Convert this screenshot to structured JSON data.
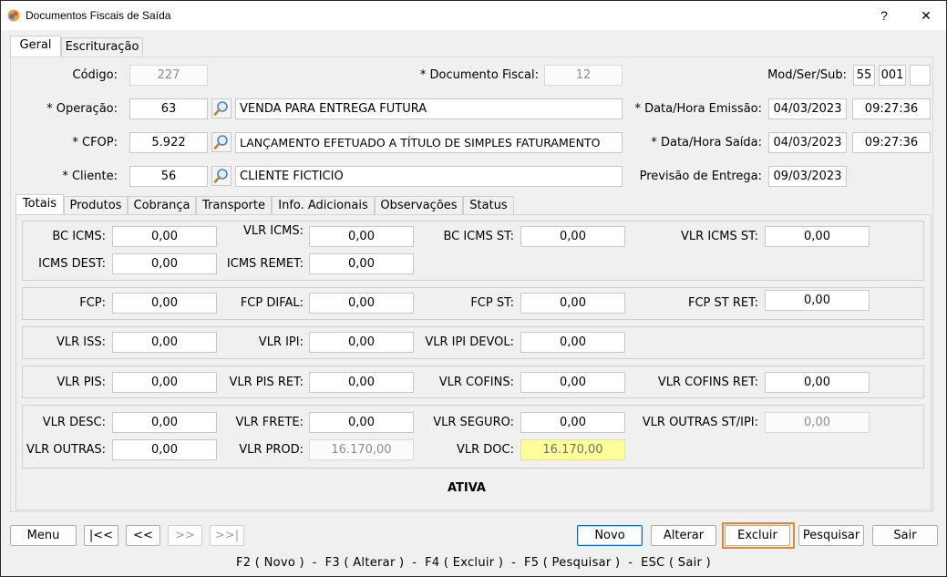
{
  "window": {
    "title": "Documentos Fiscais de Saída",
    "help_label": "?",
    "close_label": "✕"
  },
  "main_tabs": [
    {
      "label": "Geral",
      "active": true
    },
    {
      "label": "Escrituração",
      "active": false
    }
  ],
  "header": {
    "codigo_label": "Código:",
    "codigo_value": "227",
    "documento_fiscal_label": "* Documento Fiscal:",
    "documento_fiscal_value": "12",
    "mod_ser_sub_label": "Mod/Ser/Sub:",
    "mod_value": "55",
    "ser_value": "001",
    "sub_value": "",
    "operacao_label": "* Operação:",
    "operacao_code": "63",
    "operacao_desc": "VENDA PARA ENTREGA FUTURA",
    "data_hora_emissao_label": "* Data/Hora Emissão:",
    "data_emissao": "04/03/2023",
    "hora_emissao": "09:27:36",
    "cfop_label": "* CFOP:",
    "cfop_code": "5.922",
    "cfop_desc": "LANÇAMENTO EFETUADO A TÍTULO DE SIMPLES FATURAMENTO",
    "data_hora_saida_label": "* Data/Hora Saída:",
    "data_saida": "04/03/2023",
    "hora_saida": "09:27:36",
    "cliente_label": "* Cliente:",
    "cliente_code": "56",
    "cliente_desc": "CLIENTE FICTICIO",
    "previsao_entrega_label": "Previsão de Entrega:",
    "previsao_entrega_value": "09/03/2023"
  },
  "sub_tabs": [
    {
      "label": "Totais",
      "active": true
    },
    {
      "label": "Produtos",
      "active": false
    },
    {
      "label": "Cobrança",
      "active": false
    },
    {
      "label": "Transporte",
      "active": false
    },
    {
      "label": "Info. Adicionais",
      "active": false
    },
    {
      "label": "Observações",
      "active": false
    },
    {
      "label": "Status",
      "active": false
    }
  ],
  "totais": {
    "bc_icms_label": "BC ICMS:",
    "bc_icms": "0,00",
    "vlr_icms_label": "VLR ICMS:",
    "vlr_icms": "0,00",
    "bc_icms_st_label": "BC ICMS ST:",
    "bc_icms_st": "0,00",
    "vlr_icms_st_label": "VLR ICMS ST:",
    "vlr_icms_st": "0,00",
    "icms_dest_label": "ICMS DEST:",
    "icms_dest": "0,00",
    "icms_remet_label": "ICMS REMET:",
    "icms_remet": "0,00",
    "fcp_label": "FCP:",
    "fcp": "0,00",
    "fcp_difal_label": "FCP DIFAL:",
    "fcp_difal": "0,00",
    "fcp_st_label": "FCP ST:",
    "fcp_st": "0,00",
    "fcp_st_ret_label": "FCP ST RET:",
    "fcp_st_ret": "0,00",
    "vlr_iss_label": "VLR ISS:",
    "vlr_iss": "0,00",
    "vlr_ipi_label": "VLR IPI:",
    "vlr_ipi": "0,00",
    "vlr_ipi_devol_label": "VLR IPI DEVOL:",
    "vlr_ipi_devol": "0,00",
    "vlr_pis_label": "VLR PIS:",
    "vlr_pis": "0,00",
    "vlr_pis_ret_label": "VLR PIS RET:",
    "vlr_pis_ret": "0,00",
    "vlr_cofins_label": "VLR COFINS:",
    "vlr_cofins": "0,00",
    "vlr_cofins_ret_label": "VLR COFINS RET:",
    "vlr_cofins_ret": "0,00",
    "vlr_desc_label": "VLR DESC:",
    "vlr_desc": "0,00",
    "vlr_frete_label": "VLR FRETE:",
    "vlr_frete": "0,00",
    "vlr_seguro_label": "VLR SEGURO:",
    "vlr_seguro": "0,00",
    "vlr_outras_st_ipi_label": "VLR OUTRAS ST/IPI:",
    "vlr_outras_st_ipi": "0,00",
    "vlr_outras_label": "VLR OUTRAS:",
    "vlr_outras": "0,00",
    "vlr_prod_label": "VLR PROD:",
    "vlr_prod": "16.170,00",
    "vlr_doc_label": "VLR DOC:",
    "vlr_doc": "16.170,00"
  },
  "status_text": "ATIVA",
  "buttons": {
    "menu": "Menu",
    "first": "|<<",
    "prev": "<<",
    "next": ">>",
    "last": ">>|",
    "novo": "Novo",
    "alterar": "Alterar",
    "excluir": "Excluir",
    "pesquisar": "Pesquisar",
    "sair": "Sair"
  },
  "hotkeys": "F2 ( Novo )  -  F3 ( Alterar )  -  F4 ( Excluir )  -  F5 ( Pesquisar )  -  ESC ( Sair )",
  "colors": {
    "highlight_outline": "#e0892a",
    "total_doc_bg": "#ffff99",
    "focus_border": "#0f6bb5"
  }
}
